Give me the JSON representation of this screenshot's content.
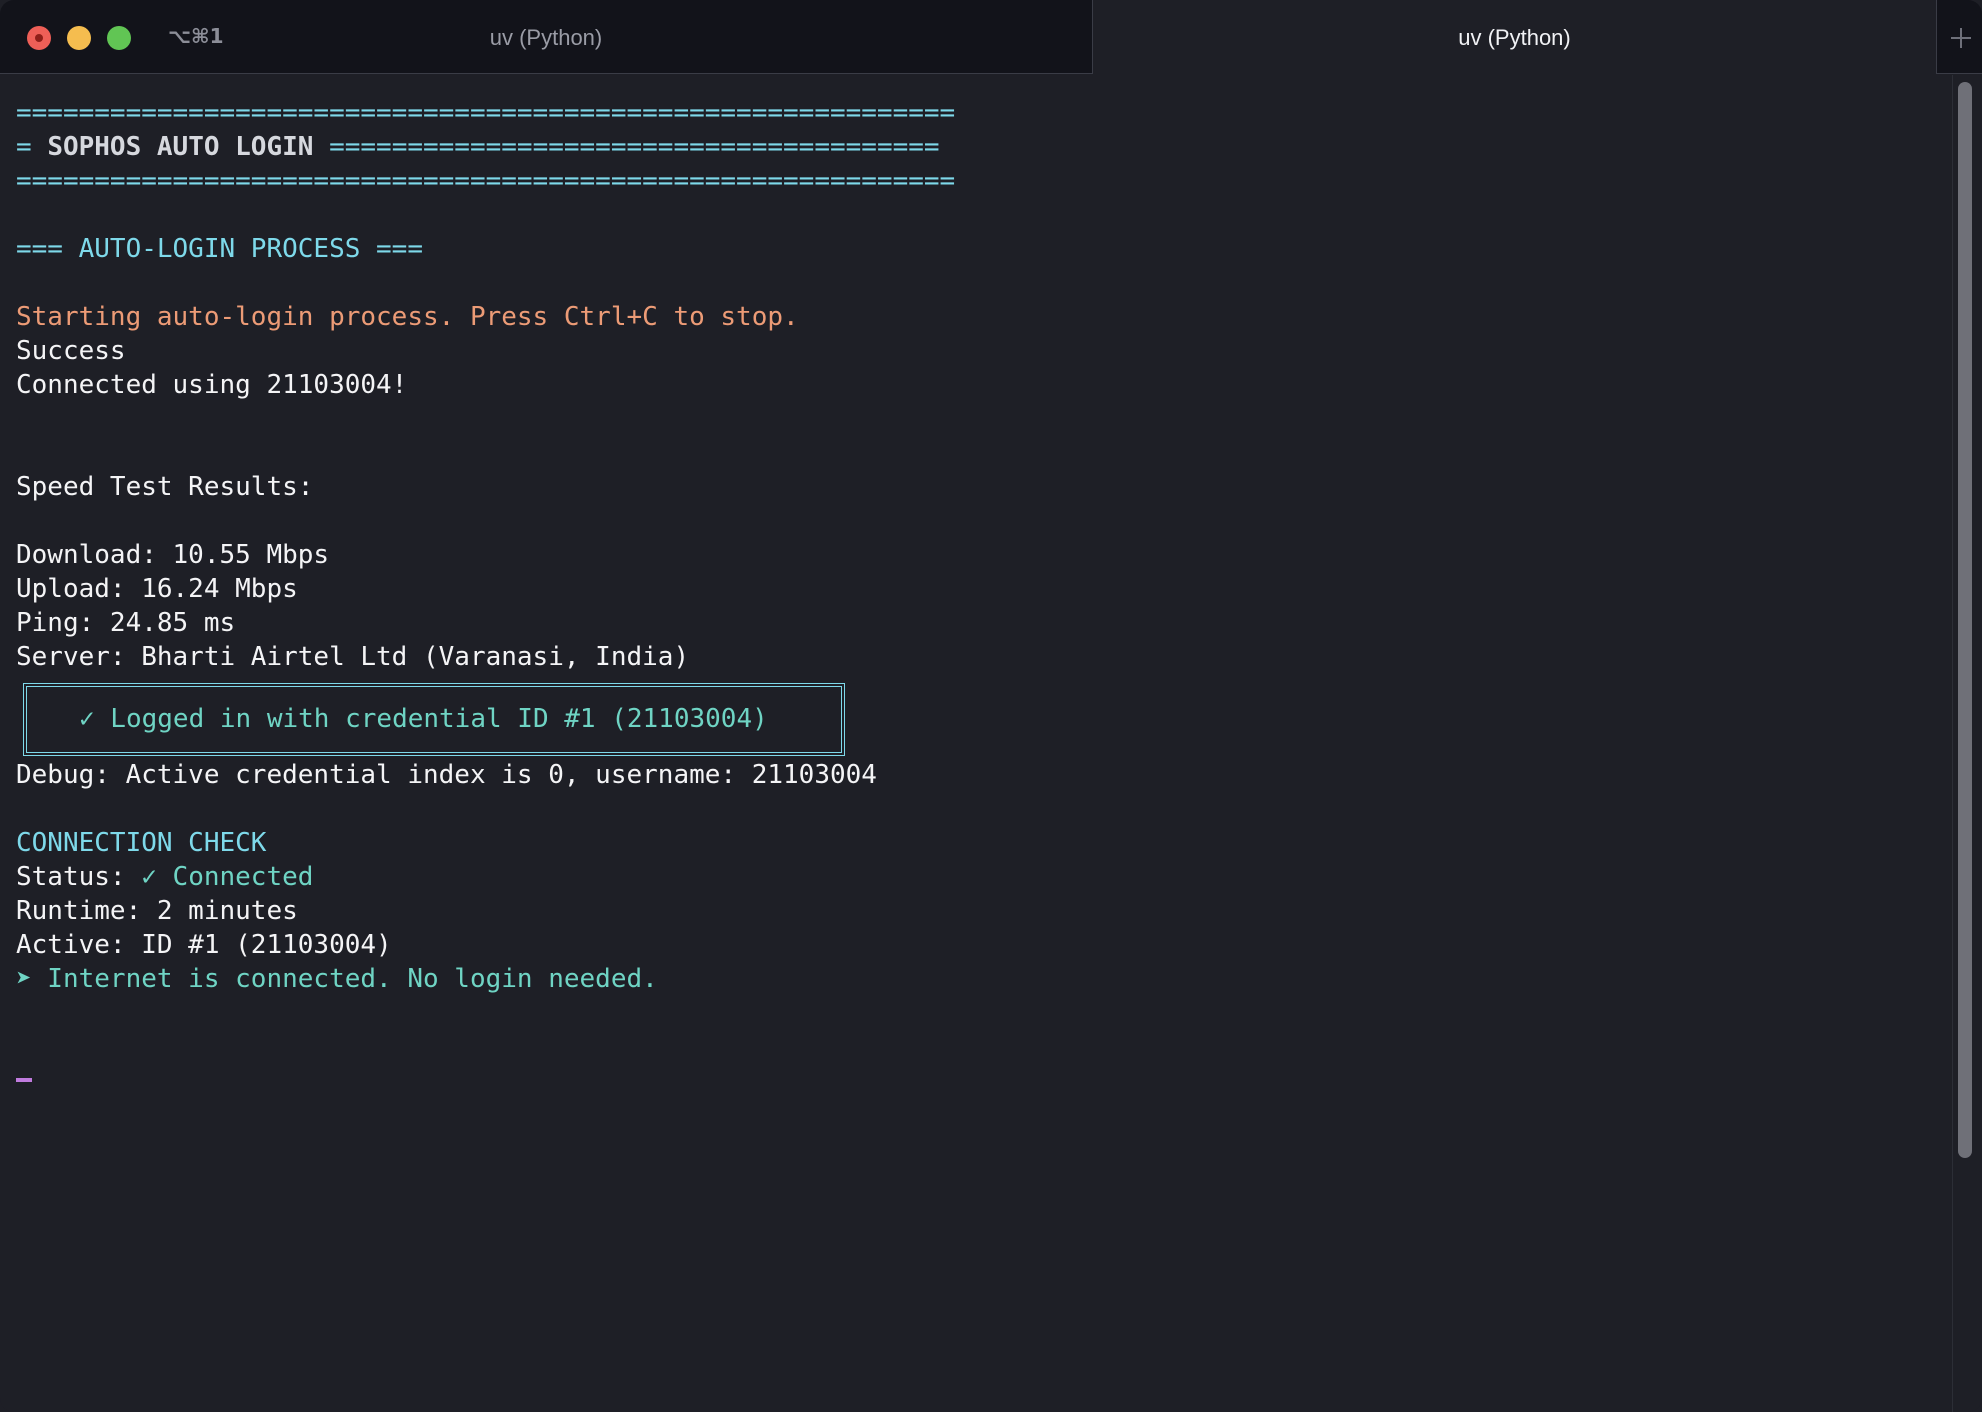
{
  "window": {
    "shortcut": "⌥⌘1",
    "tabs": [
      {
        "title": "uv (Python)",
        "active": false
      },
      {
        "title": "uv (Python)",
        "active": true
      }
    ]
  },
  "terminal": {
    "banner_rule": "============================================================",
    "banner_prefix": "= ",
    "banner_title": "SOPHOS AUTO LOGIN",
    "banner_suffix": " =======================================",
    "section_heading": "=== AUTO-LOGIN PROCESS ===",
    "start_message": "Starting auto-login process. Press Ctrl+C to stop.",
    "success": "Success",
    "connected_using": "Connected using 21103004!",
    "speed_test_heading": "Speed Test Results:",
    "download": "Download: 10.55 Mbps",
    "upload": "Upload: 16.24 Mbps",
    "ping": "Ping: 24.85 ms",
    "server": "Server: Bharti Airtel Ltd (Varanasi, India)",
    "login_box": "✓ Logged in with credential ID #1 (21103004)",
    "debug": "Debug: Active credential index is 0, username: 21103004",
    "connection_check_heading": "CONNECTION CHECK",
    "status_label": "Status: ",
    "status_value": "✓ Connected",
    "runtime": "Runtime: 2 minutes",
    "active": "Active: ID #1 (21103004)",
    "internet_message": "➤ Internet is connected. No login needed."
  },
  "colors": {
    "background": "#1e1f26",
    "cyan": "#7ed9ea",
    "teal": "#6fd4c4",
    "orange": "#ec9b76",
    "cursor": "#c07bde"
  }
}
